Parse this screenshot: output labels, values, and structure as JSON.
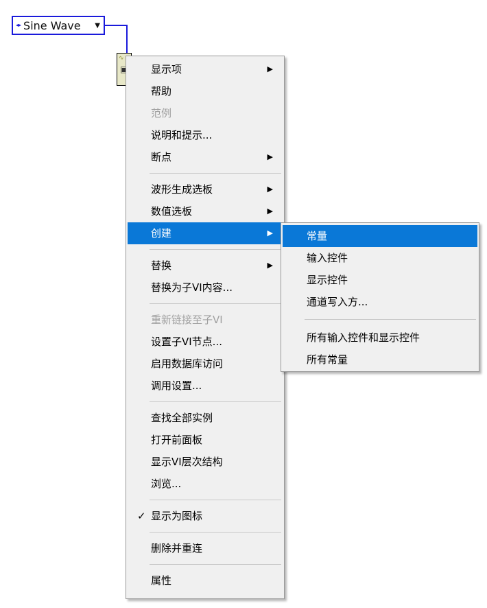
{
  "enum_constant": {
    "value": "Sine Wave",
    "arrows_icon": "increment-decrement-icon",
    "dropdown_icon": "dropdown-arrow-icon"
  },
  "colors": {
    "wire": "#1a1adb",
    "menu_bg": "#f0f0f0",
    "highlight": "#0a78d7",
    "disabled": "#a0a0a0"
  },
  "context_menu": {
    "g1": [
      {
        "label": "显示项",
        "submenu": true
      },
      {
        "label": "帮助"
      },
      {
        "label": "范例",
        "disabled": true
      },
      {
        "label": "说明和提示..."
      },
      {
        "label": "断点",
        "submenu": true
      }
    ],
    "g2": [
      {
        "label": "波形生成选板",
        "submenu": true
      },
      {
        "label": "数值选板",
        "submenu": true
      },
      {
        "label": "创建",
        "submenu": true,
        "highlighted": true
      }
    ],
    "g3": [
      {
        "label": "替换",
        "submenu": true
      },
      {
        "label": "替换为子VI内容..."
      }
    ],
    "g4": [
      {
        "label": "重新链接至子VI",
        "disabled": true
      },
      {
        "label": "设置子VI节点..."
      },
      {
        "label": "启用数据库访问"
      },
      {
        "label": "调用设置..."
      }
    ],
    "g5": [
      {
        "label": "查找全部实例"
      },
      {
        "label": "打开前面板"
      },
      {
        "label": "显示VI层次结构"
      },
      {
        "label": "浏览..."
      }
    ],
    "g6": [
      {
        "label": "显示为图标",
        "checked": true
      }
    ],
    "g7": [
      {
        "label": "删除并重连"
      }
    ],
    "g8": [
      {
        "label": "属性"
      }
    ]
  },
  "create_submenu": {
    "g1": [
      {
        "label": "常量",
        "highlighted": true
      },
      {
        "label": "输入控件"
      },
      {
        "label": "显示控件"
      },
      {
        "label": "通道写入方..."
      }
    ],
    "g2": [
      {
        "label": "所有输入控件和显示控件"
      },
      {
        "label": "所有常量"
      }
    ]
  }
}
